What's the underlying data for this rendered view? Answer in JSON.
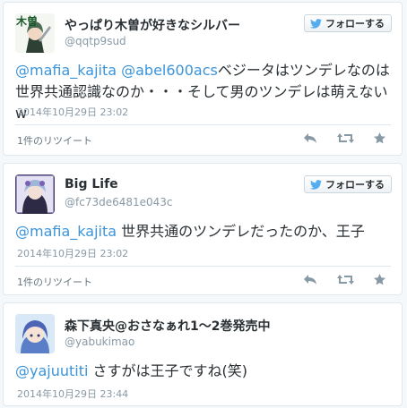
{
  "follow_label": "フォローする",
  "tweets": [
    {
      "name": "やっぱり木曽が好きなシルバー",
      "handle": "@qqtp9sud",
      "mentions": [
        "@mafia_kajita",
        "@abel600acs"
      ],
      "text": "ベジータはツンデレなのは世界共通認識なのか・・・そして男のツンデレは萌えないw",
      "date": "2014年10月29日 23:02",
      "retweet_count": "1件のリツイート",
      "avatar_text": "木曽"
    },
    {
      "name": "Big Life",
      "handle": "@fc73de6481e043c",
      "mentions": [
        "@mafia_kajita"
      ],
      "text": "世界共通のツンデレだったのか、王子",
      "date": "2014年10月29日 23:02",
      "retweet_count": "1件のリツイート"
    },
    {
      "name": "森下真央@おさなぁれ1～2巻発売中",
      "handle": "@yabukimao",
      "mentions": [
        "@yajuutiti"
      ],
      "text": "さすがは王子ですね(笑)",
      "date": "2014年10月29日 23:44"
    }
  ],
  "colors": {
    "link": "#3b94d9",
    "twitter_blue": "#55acee",
    "muted": "#8899a6"
  },
  "icons": [
    "twitter-bird-icon",
    "reply-icon",
    "retweet-icon",
    "favorite-icon"
  ]
}
